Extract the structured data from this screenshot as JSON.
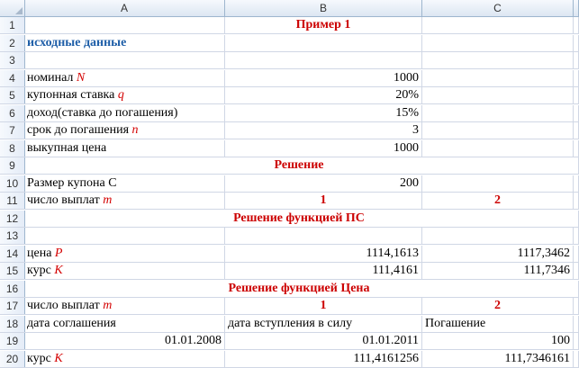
{
  "columns": [
    "A",
    "B",
    "C"
  ],
  "rows": [
    {
      "num": "1",
      "b_title": "Пример 1"
    },
    {
      "num": "2",
      "a": "исходные данные",
      "a_style": "blue"
    },
    {
      "num": "3"
    },
    {
      "num": "4",
      "a": "номинал",
      "a_var": "N",
      "b": "1000"
    },
    {
      "num": "5",
      "a": "купонная ставка",
      "a_var": "q",
      "b": "20%"
    },
    {
      "num": "6",
      "a": "доход(ставка до погашения)",
      "b": "15%"
    },
    {
      "num": "7",
      "a": "срок до погашения",
      "a_var": "n",
      "b": "3"
    },
    {
      "num": "8",
      "a": "выкупная цена",
      "b": "1000"
    },
    {
      "num": "9",
      "title": "Решение"
    },
    {
      "num": "10",
      "a": "Размер купона С",
      "b": "200"
    },
    {
      "num": "11",
      "a": "число выплат",
      "a_var": "m",
      "b": "1",
      "c": "2",
      "bc_style": "red"
    },
    {
      "num": "12",
      "title": "Решение функцией ПС"
    },
    {
      "num": "13"
    },
    {
      "num": "14",
      "a": "цена",
      "a_var": "P",
      "b": "1114,1613",
      "c": "1117,3462"
    },
    {
      "num": "15",
      "a": "курс",
      "a_var": "K",
      "b": "111,4161",
      "c": "111,7346"
    },
    {
      "num": "16",
      "title": "Решение функцией Цена"
    },
    {
      "num": "17",
      "a": "число выплат",
      "a_var": "m",
      "b": "1",
      "c": "2",
      "bc_style": "red"
    },
    {
      "num": "18",
      "a": "дата соглашения",
      "b": "дата вступления в силу",
      "c": "Погашение",
      "left_text": true
    },
    {
      "num": "19",
      "a": "01.01.2008",
      "a_right": true,
      "b": "01.01.2011",
      "c": "100"
    },
    {
      "num": "20",
      "a": "курс",
      "a_var": "K",
      "b": "111,4161256",
      "c": "111,7346161"
    }
  ]
}
